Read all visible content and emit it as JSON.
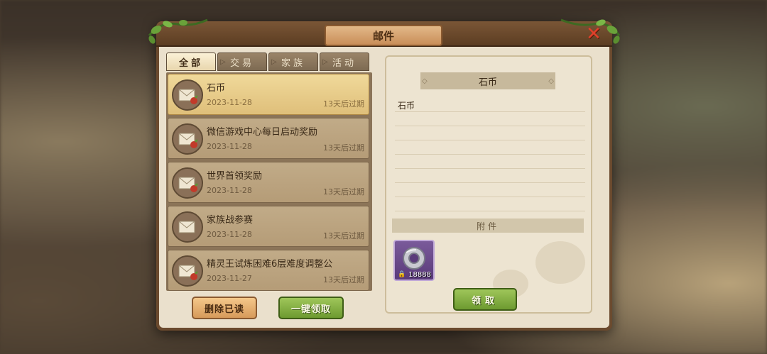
{
  "dialog": {
    "title": "邮件"
  },
  "tabs": [
    {
      "label": "全部",
      "active": true
    },
    {
      "label": "交易",
      "active": false
    },
    {
      "label": "家族",
      "active": false
    },
    {
      "label": "活动",
      "active": false
    }
  ],
  "mails": [
    {
      "title": "石币",
      "date": "2023-11-28",
      "expire": "13天后过期",
      "selected": true
    },
    {
      "title": "微信游戏中心每日启动奖励",
      "date": "2023-11-28",
      "expire": "13天后过期",
      "selected": false
    },
    {
      "title": "世界首领奖励",
      "date": "2023-11-28",
      "expire": "13天后过期",
      "selected": false
    },
    {
      "title": "家族战参赛",
      "date": "2023-11-28",
      "expire": "13天后过期",
      "selected": false
    },
    {
      "title": "精灵王试炼困难6层难度调整公",
      "date": "2023-11-27",
      "expire": "13天后过期",
      "selected": false
    }
  ],
  "buttons": {
    "delete_read": "删除已读",
    "claim_all": "一键领取",
    "claim": "领取"
  },
  "detail": {
    "title": "石币",
    "body": "石币",
    "attachment_header": "附件",
    "attachment": {
      "icon": "stone-coin-icon",
      "count": "18888"
    }
  },
  "close_label": "✕"
}
